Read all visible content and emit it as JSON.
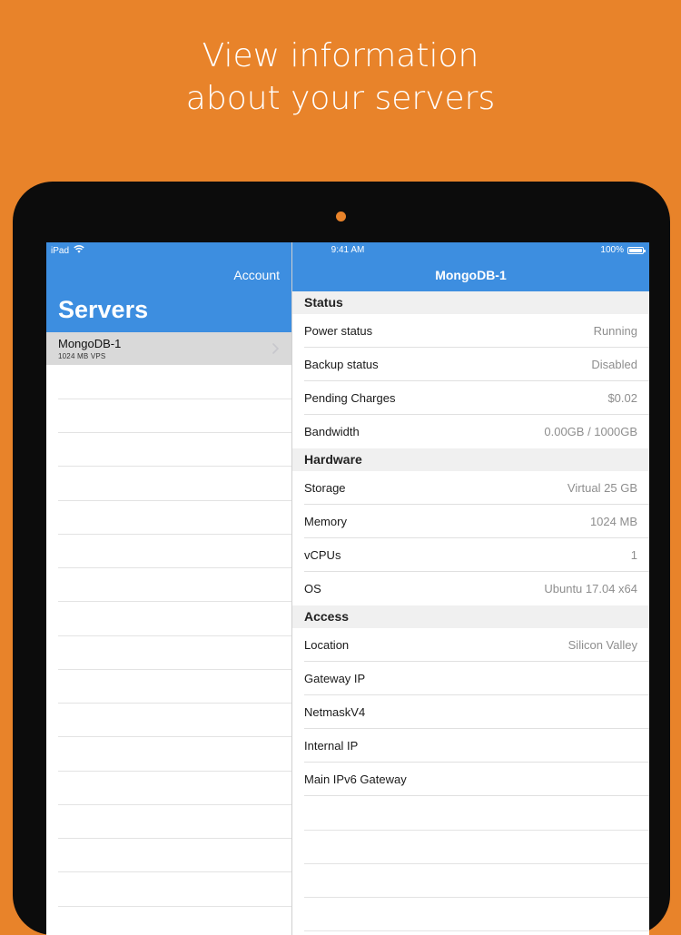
{
  "headline": {
    "line1": "View information",
    "line2": "about your servers"
  },
  "status_bar": {
    "device": "iPad",
    "time": "9:41 AM",
    "battery": "100%"
  },
  "master": {
    "account_label": "Account",
    "title": "Servers",
    "servers": [
      {
        "name": "MongoDB-1",
        "subtitle": "1024 MB VPS"
      }
    ]
  },
  "detail": {
    "title": "MongoDB-1",
    "sections": [
      {
        "header": "Status",
        "rows": [
          {
            "label": "Power status",
            "value": "Running"
          },
          {
            "label": "Backup status",
            "value": "Disabled"
          },
          {
            "label": "Pending Charges",
            "value": "$0.02"
          },
          {
            "label": "Bandwidth",
            "value": "0.00GB / 1000GB"
          }
        ]
      },
      {
        "header": "Hardware",
        "rows": [
          {
            "label": "Storage",
            "value": "Virtual 25 GB"
          },
          {
            "label": "Memory",
            "value": "1024 MB"
          },
          {
            "label": "vCPUs",
            "value": "1"
          },
          {
            "label": "OS",
            "value": "Ubuntu 17.04 x64"
          }
        ]
      },
      {
        "header": "Access",
        "rows": [
          {
            "label": "Location",
            "value": "Silicon Valley"
          },
          {
            "label": "Gateway IP",
            "value": ""
          },
          {
            "label": "NetmaskV4",
            "value": ""
          },
          {
            "label": "Internal IP",
            "value": ""
          },
          {
            "label": "Main IPv6 Gateway",
            "value": ""
          }
        ]
      }
    ]
  },
  "colors": {
    "background": "#E8832A",
    "nav_bar": "#3D8EE0",
    "selected_row": "#D9D9D9"
  },
  "icons": {
    "wifi": "wifi-icon",
    "battery": "battery-icon",
    "chevron": "chevron-right-icon"
  }
}
